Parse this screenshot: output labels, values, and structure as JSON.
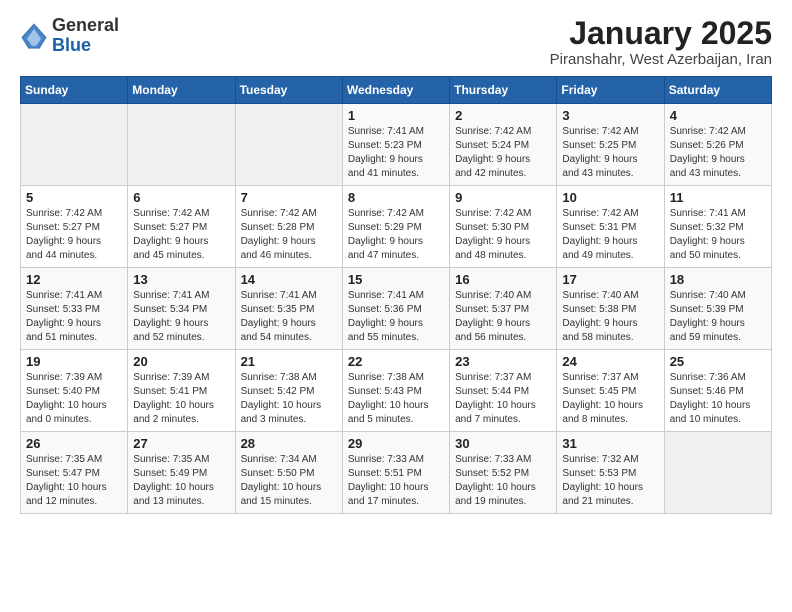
{
  "logo": {
    "text_general": "General",
    "text_blue": "Blue"
  },
  "title": "January 2025",
  "subtitle": "Piranshahr, West Azerbaijan, Iran",
  "days_of_week": [
    "Sunday",
    "Monday",
    "Tuesday",
    "Wednesday",
    "Thursday",
    "Friday",
    "Saturday"
  ],
  "weeks": [
    [
      {
        "day": "",
        "info": ""
      },
      {
        "day": "",
        "info": ""
      },
      {
        "day": "",
        "info": ""
      },
      {
        "day": "1",
        "info": "Sunrise: 7:41 AM\nSunset: 5:23 PM\nDaylight: 9 hours\nand 41 minutes."
      },
      {
        "day": "2",
        "info": "Sunrise: 7:42 AM\nSunset: 5:24 PM\nDaylight: 9 hours\nand 42 minutes."
      },
      {
        "day": "3",
        "info": "Sunrise: 7:42 AM\nSunset: 5:25 PM\nDaylight: 9 hours\nand 43 minutes."
      },
      {
        "day": "4",
        "info": "Sunrise: 7:42 AM\nSunset: 5:26 PM\nDaylight: 9 hours\nand 43 minutes."
      }
    ],
    [
      {
        "day": "5",
        "info": "Sunrise: 7:42 AM\nSunset: 5:27 PM\nDaylight: 9 hours\nand 44 minutes."
      },
      {
        "day": "6",
        "info": "Sunrise: 7:42 AM\nSunset: 5:27 PM\nDaylight: 9 hours\nand 45 minutes."
      },
      {
        "day": "7",
        "info": "Sunrise: 7:42 AM\nSunset: 5:28 PM\nDaylight: 9 hours\nand 46 minutes."
      },
      {
        "day": "8",
        "info": "Sunrise: 7:42 AM\nSunset: 5:29 PM\nDaylight: 9 hours\nand 47 minutes."
      },
      {
        "day": "9",
        "info": "Sunrise: 7:42 AM\nSunset: 5:30 PM\nDaylight: 9 hours\nand 48 minutes."
      },
      {
        "day": "10",
        "info": "Sunrise: 7:42 AM\nSunset: 5:31 PM\nDaylight: 9 hours\nand 49 minutes."
      },
      {
        "day": "11",
        "info": "Sunrise: 7:41 AM\nSunset: 5:32 PM\nDaylight: 9 hours\nand 50 minutes."
      }
    ],
    [
      {
        "day": "12",
        "info": "Sunrise: 7:41 AM\nSunset: 5:33 PM\nDaylight: 9 hours\nand 51 minutes."
      },
      {
        "day": "13",
        "info": "Sunrise: 7:41 AM\nSunset: 5:34 PM\nDaylight: 9 hours\nand 52 minutes."
      },
      {
        "day": "14",
        "info": "Sunrise: 7:41 AM\nSunset: 5:35 PM\nDaylight: 9 hours\nand 54 minutes."
      },
      {
        "day": "15",
        "info": "Sunrise: 7:41 AM\nSunset: 5:36 PM\nDaylight: 9 hours\nand 55 minutes."
      },
      {
        "day": "16",
        "info": "Sunrise: 7:40 AM\nSunset: 5:37 PM\nDaylight: 9 hours\nand 56 minutes."
      },
      {
        "day": "17",
        "info": "Sunrise: 7:40 AM\nSunset: 5:38 PM\nDaylight: 9 hours\nand 58 minutes."
      },
      {
        "day": "18",
        "info": "Sunrise: 7:40 AM\nSunset: 5:39 PM\nDaylight: 9 hours\nand 59 minutes."
      }
    ],
    [
      {
        "day": "19",
        "info": "Sunrise: 7:39 AM\nSunset: 5:40 PM\nDaylight: 10 hours\nand 0 minutes."
      },
      {
        "day": "20",
        "info": "Sunrise: 7:39 AM\nSunset: 5:41 PM\nDaylight: 10 hours\nand 2 minutes."
      },
      {
        "day": "21",
        "info": "Sunrise: 7:38 AM\nSunset: 5:42 PM\nDaylight: 10 hours\nand 3 minutes."
      },
      {
        "day": "22",
        "info": "Sunrise: 7:38 AM\nSunset: 5:43 PM\nDaylight: 10 hours\nand 5 minutes."
      },
      {
        "day": "23",
        "info": "Sunrise: 7:37 AM\nSunset: 5:44 PM\nDaylight: 10 hours\nand 7 minutes."
      },
      {
        "day": "24",
        "info": "Sunrise: 7:37 AM\nSunset: 5:45 PM\nDaylight: 10 hours\nand 8 minutes."
      },
      {
        "day": "25",
        "info": "Sunrise: 7:36 AM\nSunset: 5:46 PM\nDaylight: 10 hours\nand 10 minutes."
      }
    ],
    [
      {
        "day": "26",
        "info": "Sunrise: 7:35 AM\nSunset: 5:47 PM\nDaylight: 10 hours\nand 12 minutes."
      },
      {
        "day": "27",
        "info": "Sunrise: 7:35 AM\nSunset: 5:49 PM\nDaylight: 10 hours\nand 13 minutes."
      },
      {
        "day": "28",
        "info": "Sunrise: 7:34 AM\nSunset: 5:50 PM\nDaylight: 10 hours\nand 15 minutes."
      },
      {
        "day": "29",
        "info": "Sunrise: 7:33 AM\nSunset: 5:51 PM\nDaylight: 10 hours\nand 17 minutes."
      },
      {
        "day": "30",
        "info": "Sunrise: 7:33 AM\nSunset: 5:52 PM\nDaylight: 10 hours\nand 19 minutes."
      },
      {
        "day": "31",
        "info": "Sunrise: 7:32 AM\nSunset: 5:53 PM\nDaylight: 10 hours\nand 21 minutes."
      },
      {
        "day": "",
        "info": ""
      }
    ]
  ]
}
